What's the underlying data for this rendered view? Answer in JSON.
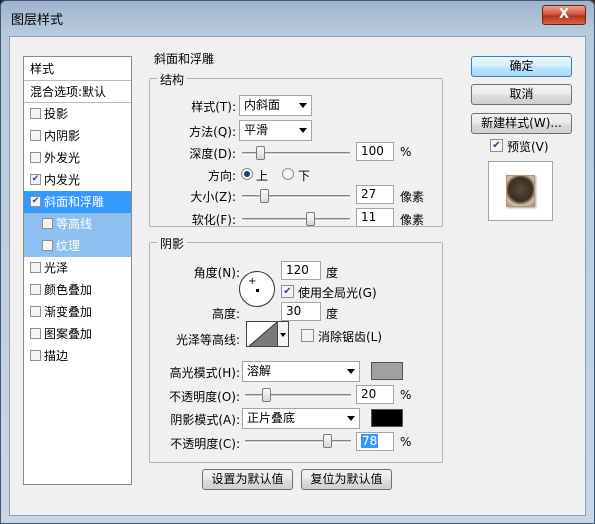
{
  "window": {
    "title": "图层样式",
    "close": "X"
  },
  "styles_panel": {
    "header": "样式",
    "blend_options": "混合选项:默认",
    "items": [
      {
        "label": "投影",
        "checked": false
      },
      {
        "label": "内阴影",
        "checked": false
      },
      {
        "label": "外发光",
        "checked": false
      },
      {
        "label": "内发光",
        "checked": true
      },
      {
        "label": "斜面和浮雕",
        "checked": true,
        "selected": true
      },
      {
        "label": "等高线",
        "checked": false,
        "sub": true
      },
      {
        "label": "纹理",
        "checked": false,
        "sub": true
      },
      {
        "label": "光泽",
        "checked": false
      },
      {
        "label": "颜色叠加",
        "checked": false
      },
      {
        "label": "渐变叠加",
        "checked": false
      },
      {
        "label": "图案叠加",
        "checked": false
      },
      {
        "label": "描边",
        "checked": false
      }
    ]
  },
  "bevel": {
    "section_title": "斜面和浮雕",
    "structure": {
      "title": "结构",
      "style_label": "样式(T):",
      "style_value": "内斜面",
      "technique_label": "方法(Q):",
      "technique_value": "平滑",
      "depth_label": "深度(D):",
      "depth_value": "100",
      "depth_unit": "%",
      "depth_percent": 100,
      "direction_label": "方向:",
      "dir_up": "上",
      "dir_down": "下",
      "direction_selected": "上",
      "size_label": "大小(Z):",
      "size_value": "27",
      "size_unit": "像素",
      "soften_label": "软化(F):",
      "soften_value": "11",
      "soften_unit": "像素"
    },
    "shading": {
      "title": "阴影",
      "angle_label": "角度(N):",
      "angle_value": "120",
      "angle_unit": "度",
      "global_light_label": "使用全局光(G)",
      "global_light_checked": true,
      "altitude_label": "高度:",
      "altitude_value": "30",
      "altitude_unit": "度",
      "gloss_contour_label": "光泽等高线:",
      "anti_alias_label": "消除锯齿(L)",
      "anti_alias_checked": false,
      "highlight_mode_label": "高光模式(H):",
      "highlight_mode_value": "溶解",
      "highlight_color": "#a0a0a0",
      "highlight_opacity_label": "不透明度(O):",
      "highlight_opacity_value": "20",
      "highlight_opacity_unit": "%",
      "shadow_mode_label": "阴影模式(A):",
      "shadow_mode_value": "正片叠底",
      "shadow_color": "#000000",
      "shadow_opacity_label": "不透明度(C):",
      "shadow_opacity_value": "78",
      "shadow_opacity_unit": "%"
    },
    "make_default": "设置为默认值",
    "reset_default": "复位为默认值"
  },
  "side": {
    "ok": "确定",
    "cancel": "取消",
    "new_style": "新建样式(W)...",
    "preview_label": "预览(V)",
    "preview_checked": true
  }
}
